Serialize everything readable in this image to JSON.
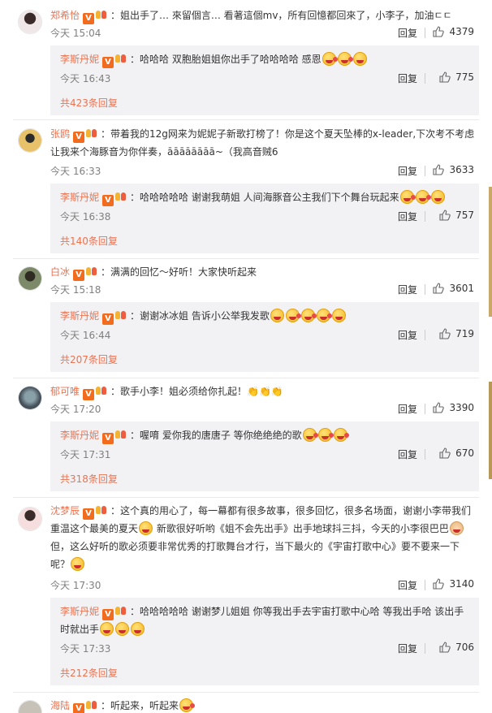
{
  "reply_label": "回复",
  "vip_badge": "V",
  "comments": [
    {
      "user": "郑希怡",
      "text": "：姐出手了… 來留個言… 看著這個mv，所有回憶都回來了，小李子，加油ㄷㄷ",
      "time": "今天 15:04",
      "likes": "4379",
      "reply": {
        "user": "李斯丹妮",
        "text": "：哈哈哈 双胞胎姐姐你出手了哈哈哈哈 感恩",
        "time": "今天 16:43",
        "likes": "775"
      },
      "total": "共423条回复"
    },
    {
      "user": "张鸥",
      "text1": "：带着我的12g网来为妮妮子新歌打榜了！你是这个夏天坠棒的x-leader,下次考不考虑",
      "text2": "让我来个海豚音为你伴奏，āāāāāāāā~（我高音贼6",
      "time": "今天 16:33",
      "likes": "3633",
      "reply": {
        "user": "李斯丹妮",
        "text": "：哈哈哈哈哈 谢谢我萌姐 人间海豚音公主我们下个舞台玩起来",
        "time": "今天 16:38",
        "likes": "757"
      },
      "total": "共140条回复"
    },
    {
      "user": "白冰",
      "text": "：满满的回忆～好听！大家快听起来",
      "time": "今天 15:18",
      "likes": "3601",
      "reply": {
        "user": "李斯丹妮",
        "text": "：谢谢冰冰姐 告诉小公举我发歌",
        "time": "今天 16:44",
        "likes": "719"
      },
      "total": "共207条回复"
    },
    {
      "user": "郁可唯",
      "text": "：歌手小李！姐必须给你扎起！👏👏👏",
      "time": "今天 17:20",
      "likes": "3390",
      "reply": {
        "user": "李斯丹妮",
        "text": "：喔唷 爱你我的唐唐子 等你绝绝绝的歌",
        "time": "今天 17:31",
        "likes": "670"
      },
      "total": "共318条回复"
    },
    {
      "user": "沈梦辰",
      "text1": "：这个真的用心了，每一幕都有很多故事，很多回忆，很多名场面，谢谢小李带我们",
      "text2": "重温这个最美的夏天",
      "text2b": "新歌很好听哟《姐不会先出手》出手地球抖三抖，今天的小李很巴巴",
      "text3": "但，这么好听的歌必须要非常优秀的打歌舞台才行，当下最火的《宇宙打歌中心》要不要来一下",
      "text4": "呢？",
      "time": "今天 17:30",
      "likes": "3140",
      "reply": {
        "user": "李斯丹妮",
        "text1": "：哈哈哈哈哈 谢谢梦儿姐姐 你等我出手去宇宙打歌中心哈 等我出手哈 该出手",
        "text2": "时就出手",
        "time": "今天 17:33",
        "likes": "706"
      },
      "total": "共212条回复"
    },
    {
      "user": "海陆",
      "text": "：听起来，听起来"
    }
  ]
}
